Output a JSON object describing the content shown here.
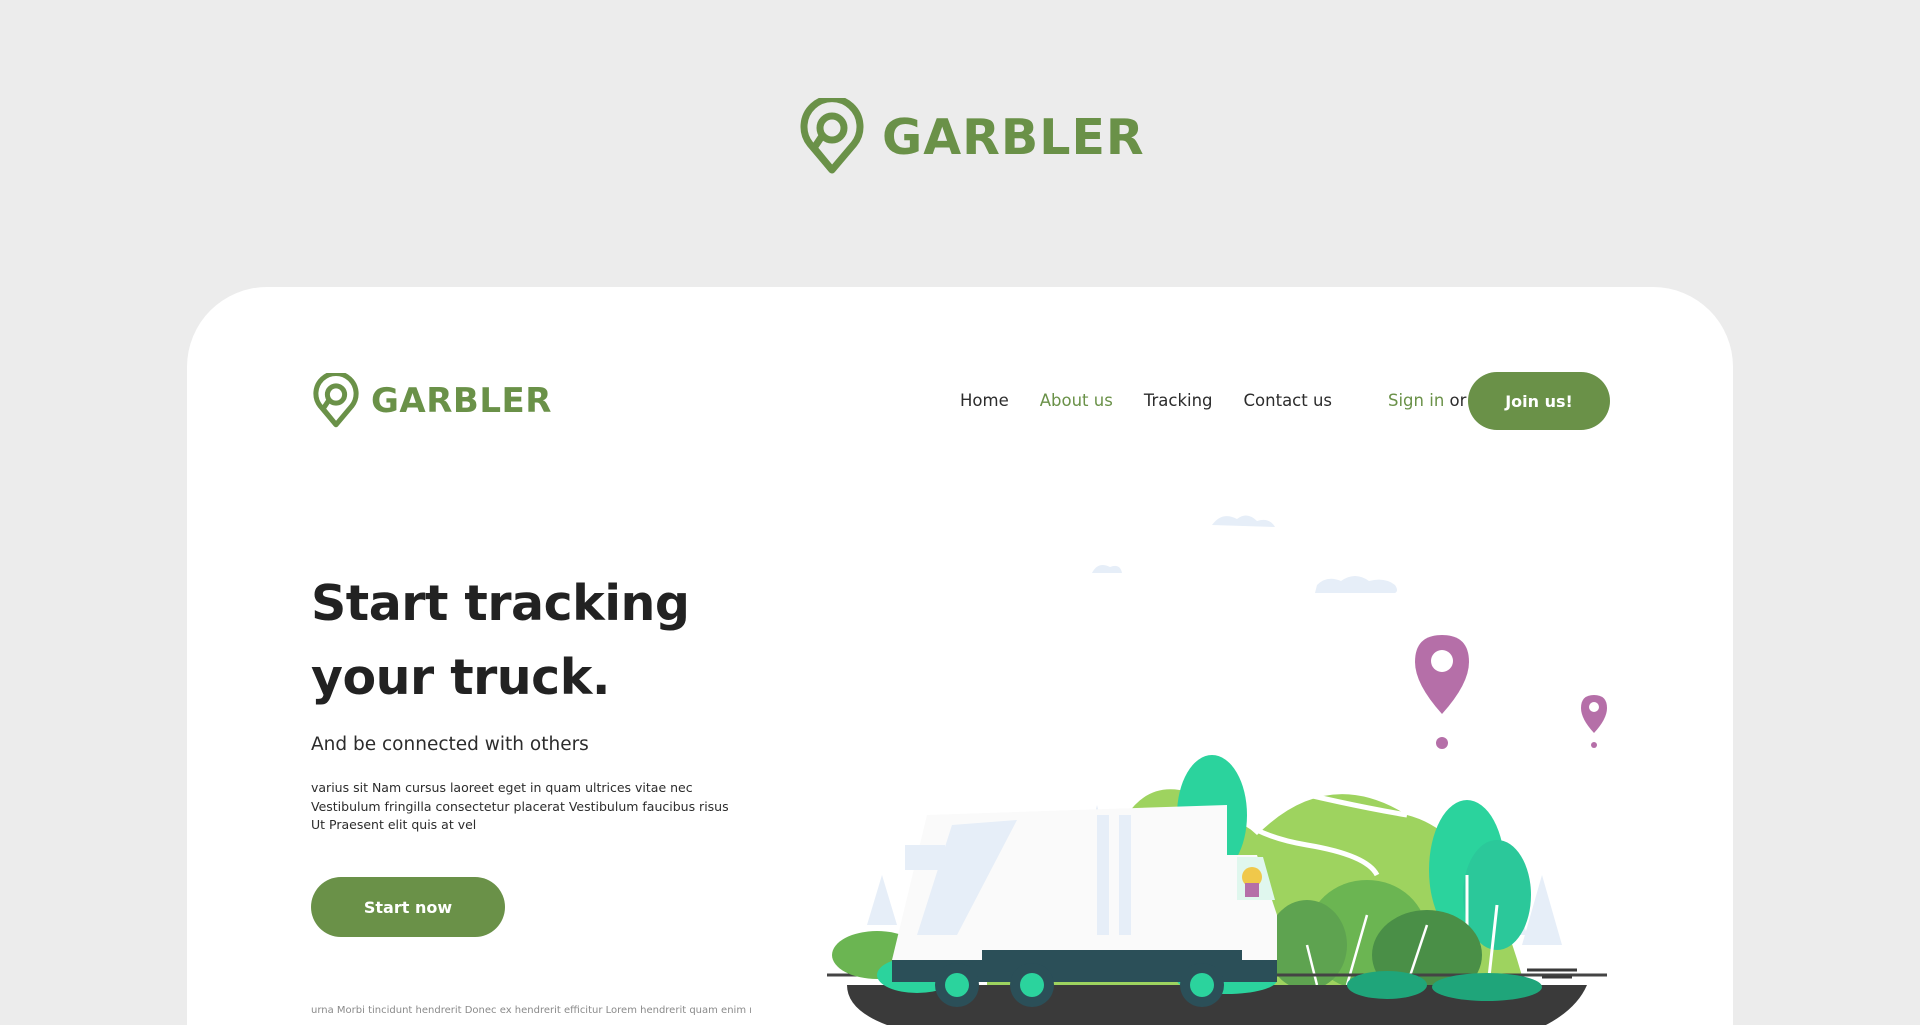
{
  "brand": {
    "name": "GARBLER",
    "color": "#6a9148",
    "logo_icon": "location-pin-icon"
  },
  "nav": {
    "links": [
      "Home",
      "About us",
      "Tracking",
      "Contact us"
    ],
    "active": "About us",
    "signin_label": "Sign in",
    "or_label": "or",
    "join_label": "Join us!"
  },
  "hero": {
    "headline_line1": "Start tracking",
    "headline_line2": "your truck.",
    "subheadline": "And be connected with others",
    "paragraph_line1": "varius sit Nam cursus laoreet eget in quam ultrices vitae nec",
    "paragraph_line2": "Vestibulum fringilla consectetur placerat Vestibulum faucibus risus",
    "paragraph_line3": "Ut Praesent elit quis at vel",
    "cta_label": "Start now",
    "footer_text": "urna Morbi tincidunt hendrerit Donec ex hendrerit efficitur Lorem hendrerit quam enim non"
  },
  "colors": {
    "background": "#ececec",
    "card": "#ffffff",
    "accent": "#6a9148",
    "pin": "#b56fa8",
    "road": "#3a3a3a",
    "truck_cab": "#2b4f58",
    "wheel_hub": "#2bd39d"
  }
}
